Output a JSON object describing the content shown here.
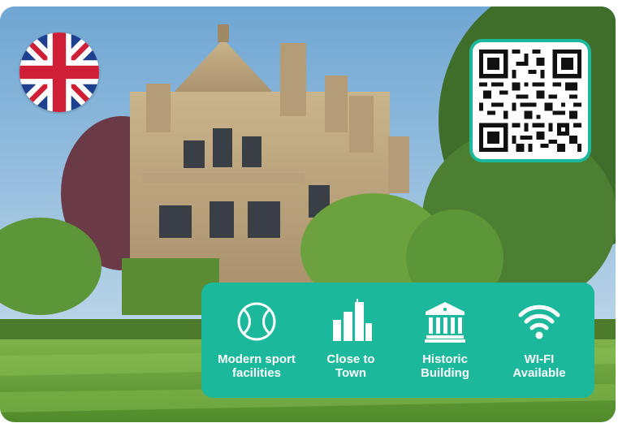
{
  "features": [
    {
      "label_line1": "Modern sport",
      "label_line2": "facilities",
      "icon": "tennis-ball-icon"
    },
    {
      "label_line1": "Close to",
      "label_line2": "Town",
      "icon": "city-buildings-icon"
    },
    {
      "label_line1": "Historic",
      "label_line2": "Building",
      "icon": "historic-building-icon"
    },
    {
      "label_line1": "WI-FI",
      "label_line2": "Available",
      "icon": "wifi-icon"
    }
  ],
  "flag": {
    "icon": "uk-flag-icon"
  },
  "qr": {
    "icon": "qr-code-icon"
  },
  "colors": {
    "accent": "#1bb89c",
    "text": "#ffffff"
  }
}
